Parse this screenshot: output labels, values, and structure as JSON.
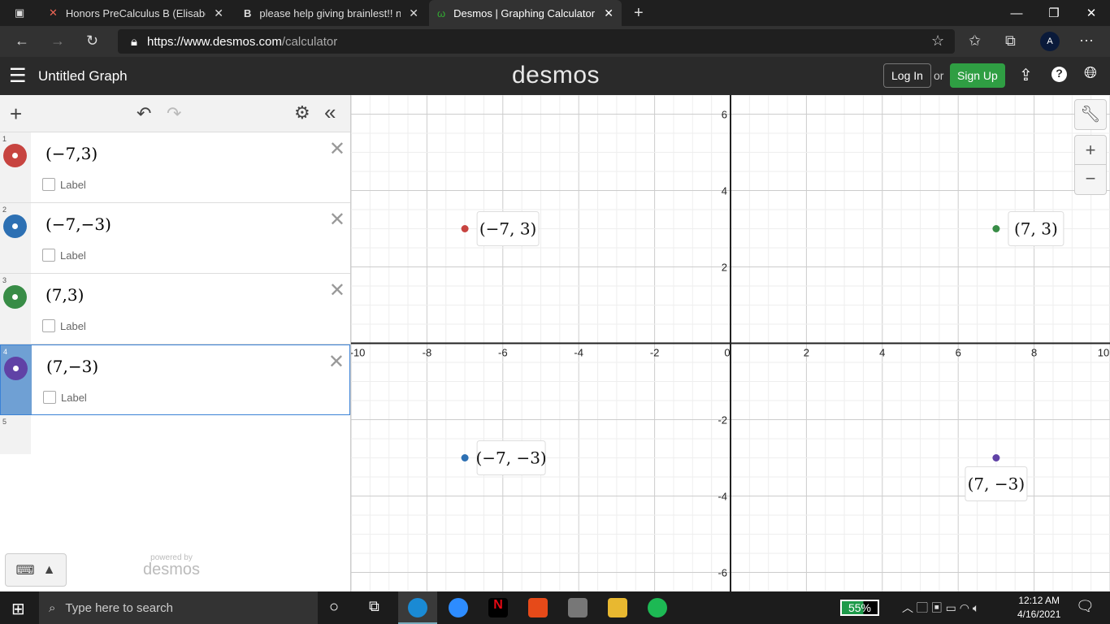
{
  "browser": {
    "tabs": [
      {
        "title": "Honors PreCalculus B (Elisabet R",
        "icon": "x-logo-icon"
      },
      {
        "title": "please help giving brainlest!! no",
        "icon": "brainly-icon"
      },
      {
        "title": "Desmos | Graphing Calculator",
        "icon": "desmos-icon"
      }
    ],
    "url_host": "https://www.desmos.com",
    "url_path": "/calculator",
    "profile": "A"
  },
  "header": {
    "title": "Untitled Graph",
    "logo": "desmos",
    "login": "Log In",
    "or": "or",
    "signup": "Sign Up"
  },
  "expressions": [
    {
      "n": "1",
      "latex": "(−7,3)",
      "color": "#c74440",
      "label": "Label"
    },
    {
      "n": "2",
      "latex": "(−7,−3)",
      "color": "#2d70b3",
      "label": "Label"
    },
    {
      "n": "3",
      "latex": "(7,3)",
      "color": "#388c46",
      "label": "Label"
    },
    {
      "n": "4",
      "latex": "(7,−3)",
      "color": "#6042a6",
      "label": "Label"
    }
  ],
  "empty_row": "5",
  "powered_by": "powered by",
  "powered_logo": "desmos",
  "chart_data": {
    "type": "scatter",
    "xlim": [
      -10,
      10
    ],
    "ylim": [
      -6.5,
      6.5
    ],
    "grid": true,
    "xticks": [
      -10,
      -8,
      -6,
      -4,
      -2,
      0,
      2,
      4,
      6,
      8,
      10
    ],
    "yticks": [
      -6,
      -4,
      -2,
      2,
      4,
      6
    ],
    "points": [
      {
        "x": -7,
        "y": 3,
        "label": "(−7, 3)",
        "color": "#c74440"
      },
      {
        "x": -7,
        "y": -3,
        "label": "(−7, −3)",
        "color": "#2d70b3"
      },
      {
        "x": 7,
        "y": 3,
        "label": "(7, 3)",
        "color": "#388c46"
      },
      {
        "x": 7,
        "y": -3,
        "label": "(7, −3)",
        "color": "#6042a6"
      }
    ]
  },
  "taskbar": {
    "search": "Type here to search",
    "battery": "55%",
    "time": "12:12 AM",
    "date": "4/16/2021"
  }
}
